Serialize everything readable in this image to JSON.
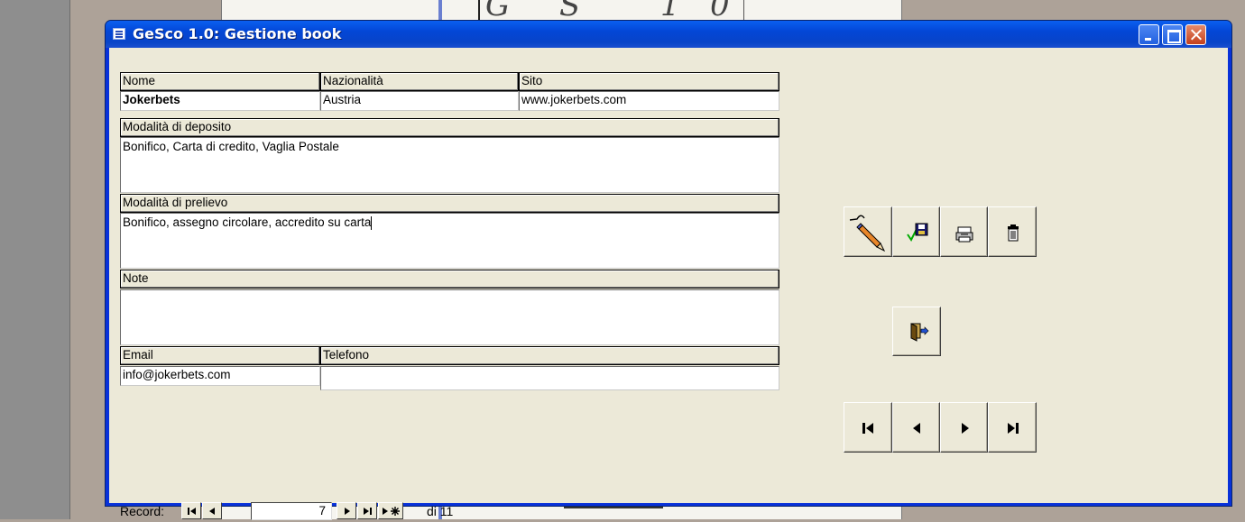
{
  "window": {
    "title": "GeSco 1.0: Gestione book"
  },
  "form": {
    "nome": {
      "label": "Nome",
      "value": "Jokerbets"
    },
    "nazionalita": {
      "label": "Nazionalità",
      "value": "Austria"
    },
    "sito": {
      "label": "Sito",
      "value": "www.jokerbets.com"
    },
    "deposito": {
      "label": "Modalità di deposito",
      "value": "Bonifico, Carta di credito, Vaglia Postale"
    },
    "prelievo": {
      "label": "Modalità di prelievo",
      "value": "Bonifico, assegno circolare, accredito su carta"
    },
    "note": {
      "label": "Note",
      "value": ""
    },
    "email": {
      "label": "Email",
      "value": "info@jokerbets.com"
    },
    "telefono": {
      "label": "Telefono",
      "value": ""
    }
  },
  "actions": {
    "icons": [
      "edit-pencil-icon",
      "save-record-icon",
      "print-icon",
      "delete-trash-icon",
      "exit-door-icon",
      "first-record-icon",
      "previous-record-icon",
      "next-record-icon",
      "last-record-icon"
    ]
  },
  "record_nav": {
    "label": "Record:",
    "current": "7",
    "of_text": "di 11"
  },
  "colors": {
    "title_bar": "#0a5ff0",
    "client_bg": "#ece9d8",
    "close_button": "#c4401c"
  }
}
